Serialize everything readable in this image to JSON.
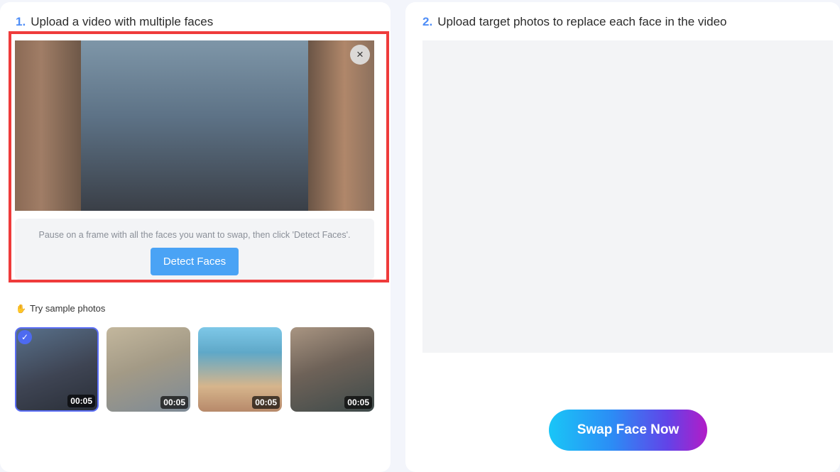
{
  "step1": {
    "number": "1.",
    "title": "Upload a video with multiple faces"
  },
  "step2": {
    "number": "2.",
    "title": "Upload target photos to replace each face in the video"
  },
  "video": {
    "close_icon": "×",
    "hint": "Pause on a frame with all the faces you want to swap, then click 'Detect Faces'.",
    "detect_label": "Detect Faces"
  },
  "samples": {
    "label": "Try sample photos",
    "hand_icon": "✋",
    "items": [
      {
        "duration": "00:05",
        "selected": true
      },
      {
        "duration": "00:05",
        "selected": false
      },
      {
        "duration": "00:05",
        "selected": false
      },
      {
        "duration": "00:05",
        "selected": false
      }
    ],
    "check_icon": "✓"
  },
  "swap": {
    "label": "Swap Face Now"
  },
  "colors": {
    "accent": "#4f8ef7",
    "highlight_border": "#ef3b3b",
    "detect_button": "#4aa3f5"
  }
}
